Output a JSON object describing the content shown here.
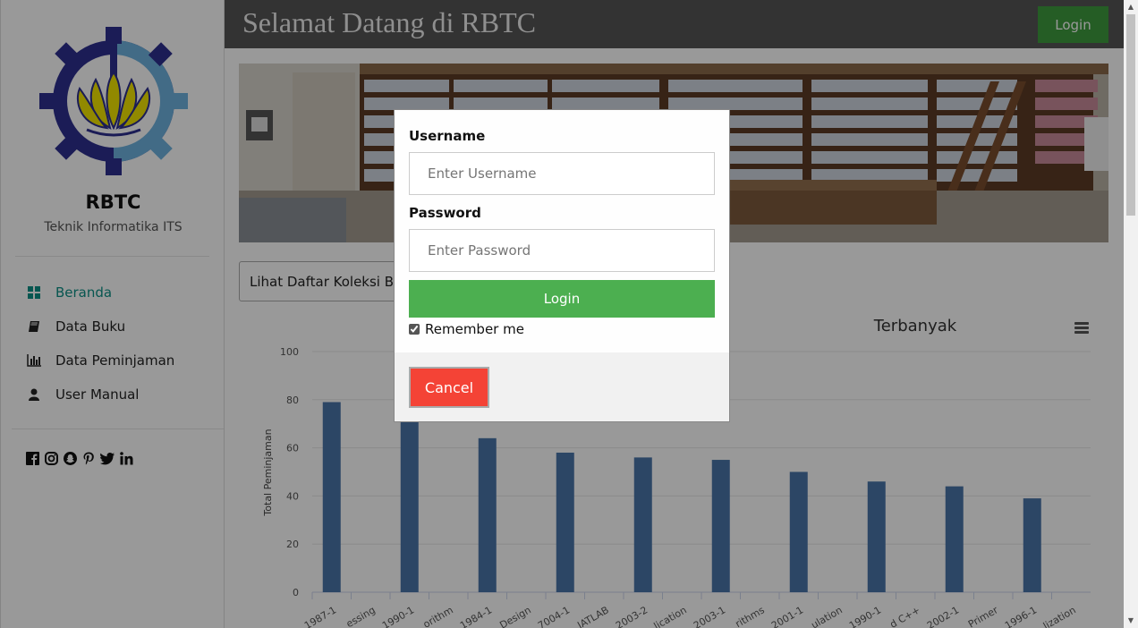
{
  "sidebar": {
    "brand": "RBTC",
    "subtitle": "Teknik Informatika ITS",
    "nav": [
      {
        "label": "Beranda",
        "icon": "dashboard-icon",
        "active": true
      },
      {
        "label": "Data Buku",
        "icon": "book-icon",
        "active": false
      },
      {
        "label": "Data Peminjaman",
        "icon": "bar-chart-icon",
        "active": false
      },
      {
        "label": "User Manual",
        "icon": "user-icon",
        "active": false
      }
    ],
    "social": [
      "facebook-icon",
      "instagram-icon",
      "snapchat-icon",
      "pinterest-icon",
      "twitter-icon",
      "linkedin-icon"
    ]
  },
  "header": {
    "title": "Selamat Datang di RBTC",
    "login_label": "Login"
  },
  "main": {
    "collection_button": "Lihat Daftar Koleksi Bu"
  },
  "chart_data": {
    "type": "bar",
    "title": "Terbanyak",
    "ylabel": "Total Peminjaman",
    "ylim": [
      0,
      100
    ],
    "yticks": [
      0,
      20,
      40,
      60,
      80,
      100
    ],
    "categories": [
      "1987-1",
      "essing",
      "1990-1",
      "orithm",
      "1984-1",
      "Design",
      "7004-1",
      "IATLAB",
      "2003-2",
      "lication",
      "2003-1",
      "rithms",
      "2001-1",
      "ulation",
      "1990-1",
      "d C++",
      "2002-1",
      "Primer",
      "1996-1",
      "lization"
    ],
    "values": [
      79,
      null,
      72,
      null,
      64,
      null,
      58,
      null,
      56,
      null,
      55,
      null,
      50,
      null,
      46,
      null,
      44,
      null,
      39,
      null
    ],
    "color": "#4a76a8"
  },
  "modal": {
    "username_label": "Username",
    "username_placeholder": "Enter Username",
    "password_label": "Password",
    "password_placeholder": "Enter Password",
    "login_label": "Login",
    "remember_label": "Remember me",
    "remember_checked": true,
    "cancel_label": "Cancel"
  },
  "colors": {
    "accent": "#0d8f86",
    "header_bg": "#555555",
    "login_green": "#4caf50",
    "cancel_red": "#f44336"
  }
}
